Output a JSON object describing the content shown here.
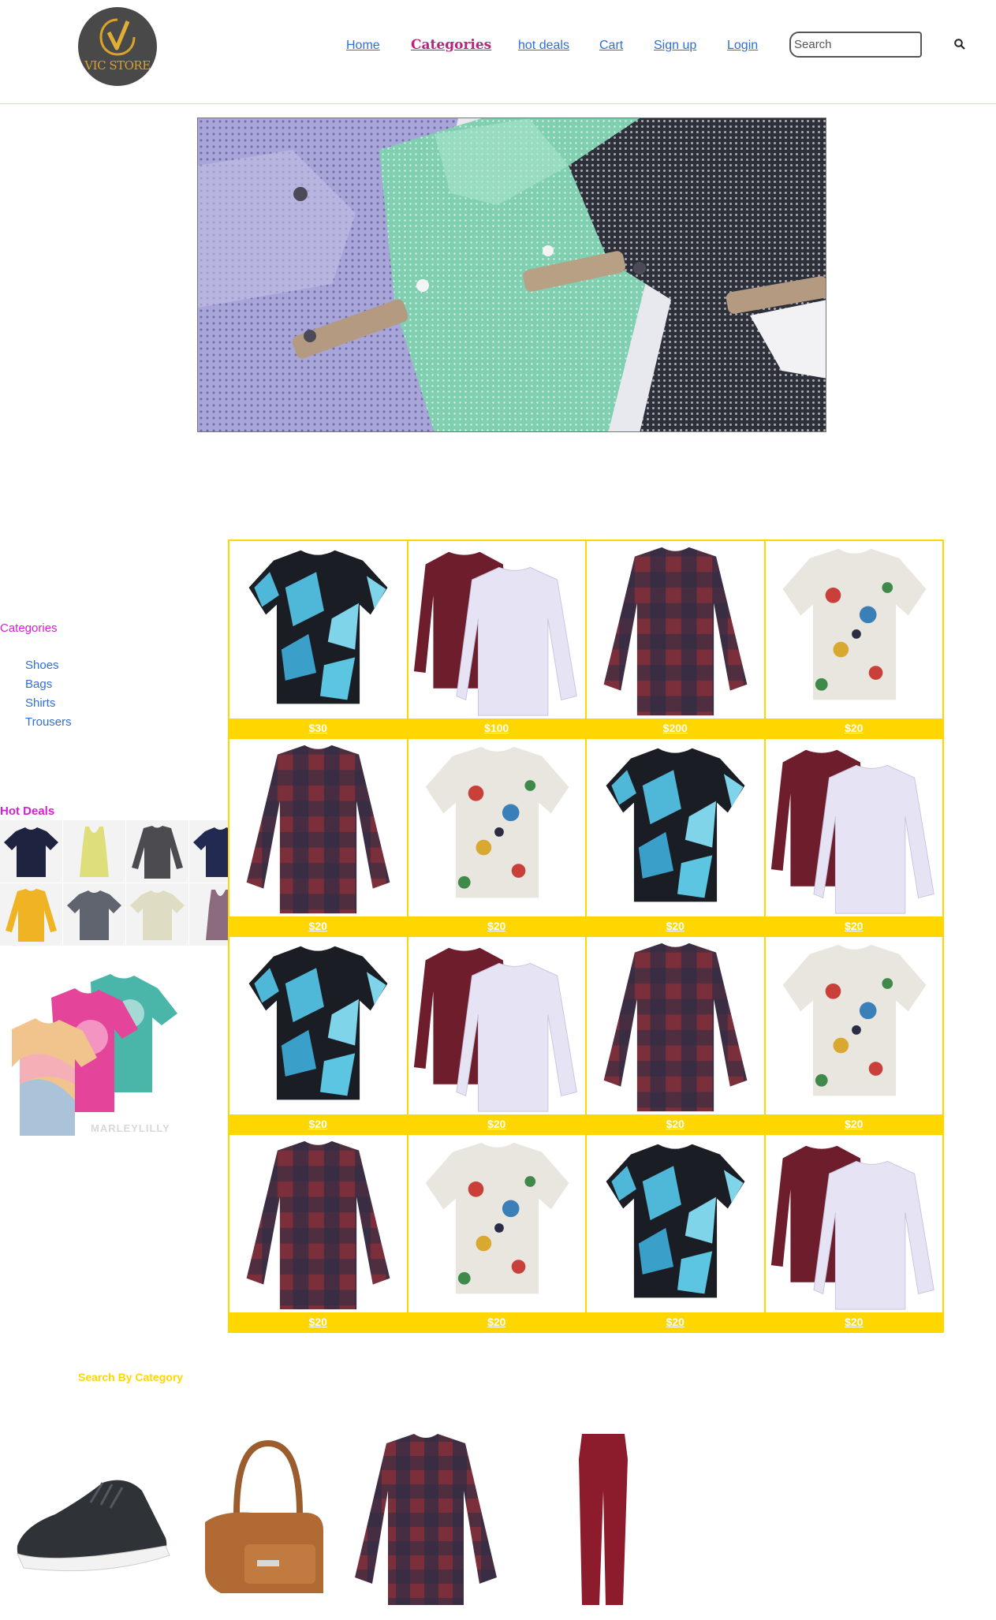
{
  "header": {
    "logo_text": "VIC STORE",
    "nav": [
      {
        "label": "Home"
      },
      {
        "label": "Categories"
      },
      {
        "label": "hot deals"
      },
      {
        "label": "Cart"
      },
      {
        "label": "Sign up"
      },
      {
        "label": "Login"
      }
    ],
    "search": {
      "placeholder": "Search",
      "value": ""
    }
  },
  "hero": {
    "image": "folded-shirts-photo"
  },
  "sidebar": {
    "categories_title": "Categories",
    "categories": [
      {
        "label": "Shoes"
      },
      {
        "label": "Bags"
      },
      {
        "label": "Shirts"
      },
      {
        "label": "Trousers"
      }
    ],
    "hot_deals_title": "Hot Deals",
    "hot_deals": [
      {
        "image": "navy-tshirt"
      },
      {
        "image": "yellow-tank-top"
      },
      {
        "image": "grey-longsleeve"
      },
      {
        "image": "navy-tshirt"
      },
      {
        "image": "yellow-longsleeve"
      },
      {
        "image": "grey-tshirt"
      },
      {
        "image": "cream-tshirt"
      },
      {
        "image": "mauve-tank-top"
      }
    ],
    "promo_image": "tie-dye-tshirts",
    "promo_watermark": "MARLEYLILLY"
  },
  "products": [
    {
      "price": "$30",
      "image": "blue-geometric-shirt"
    },
    {
      "price": "$100",
      "image": "maroon-white-shirts"
    },
    {
      "price": "$200",
      "image": "plaid-shirt"
    },
    {
      "price": "$20",
      "image": "printed-hawaiian-shirt"
    },
    {
      "price": "$20",
      "image": "plaid-shirt"
    },
    {
      "price": "$20",
      "image": "printed-hawaiian-shirt"
    },
    {
      "price": "$20",
      "image": "blue-geometric-shirt"
    },
    {
      "price": "$20",
      "image": "maroon-white-shirts"
    },
    {
      "price": "$20",
      "image": "blue-geometric-shirt"
    },
    {
      "price": "$20",
      "image": "maroon-white-shirts"
    },
    {
      "price": "$20",
      "image": "plaid-shirt"
    },
    {
      "price": "$20",
      "image": "printed-hawaiian-shirt"
    },
    {
      "price": "$20",
      "image": "plaid-shirt"
    },
    {
      "price": "$20",
      "image": "printed-hawaiian-shirt"
    },
    {
      "price": "$20",
      "image": "blue-geometric-shirt"
    },
    {
      "price": "$20",
      "image": "maroon-white-shirts"
    }
  ],
  "search_by_category": {
    "title": "Search By Category",
    "items": [
      {
        "image": "sneaker"
      },
      {
        "image": "handbag"
      },
      {
        "image": "plaid-shirt"
      },
      {
        "image": "maroon-trousers"
      }
    ]
  },
  "colors": {
    "accent_yellow": "#ffd600",
    "magenta": "#d31fd3",
    "link_blue": "#2f6fd6",
    "logo_bg": "#4a4949"
  }
}
